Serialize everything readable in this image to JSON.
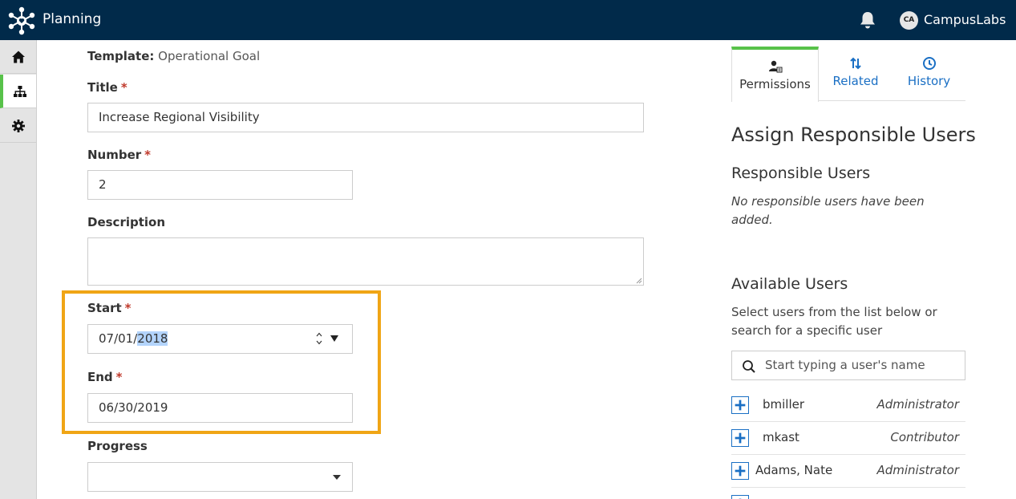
{
  "app": {
    "title": "Planning"
  },
  "user": {
    "initials": "CA",
    "name": "CampusLabs"
  },
  "colors": {
    "topbar": "#012a4a",
    "accent_green": "#58c24a",
    "link_blue": "#1a6fc4",
    "highlight": "#f0a515",
    "required": "#c0392b"
  },
  "rail": {
    "items": [
      {
        "icon": "home-icon"
      },
      {
        "icon": "hierarchy-icon",
        "active": true
      },
      {
        "icon": "gear-icon"
      }
    ]
  },
  "form": {
    "template_label": "Template:",
    "template_value": "Operational Goal",
    "required_mark": "*",
    "title": {
      "label": "Title",
      "value": "Increase Regional Visibility"
    },
    "number": {
      "label": "Number",
      "value": "2"
    },
    "description": {
      "label": "Description",
      "value": ""
    },
    "start": {
      "label": "Start",
      "value_prefix": "07/01/",
      "value_selected": "2018"
    },
    "end": {
      "label": "End",
      "value": "06/30/2019"
    },
    "progress": {
      "label": "Progress",
      "value": ""
    }
  },
  "panel": {
    "tabs": [
      {
        "label": "Permissions",
        "icon": "user-permissions-icon",
        "active": true
      },
      {
        "label": "Related",
        "icon": "up-down-arrows-icon"
      },
      {
        "label": "History",
        "icon": "clock-icon"
      }
    ],
    "heading": "Assign Responsible Users",
    "responsible_title": "Responsible Users",
    "responsible_empty": "No responsible users have been added.",
    "available_title": "Available Users",
    "available_help": "Select users from the list below or search for a specific user",
    "search_placeholder": "Start typing a user's name",
    "users": [
      {
        "name": "bmiller",
        "role": "Administrator"
      },
      {
        "name": "mkast",
        "role": "Contributor"
      },
      {
        "name": "Adams,  Nate",
        "role": "Administrator"
      }
    ]
  }
}
